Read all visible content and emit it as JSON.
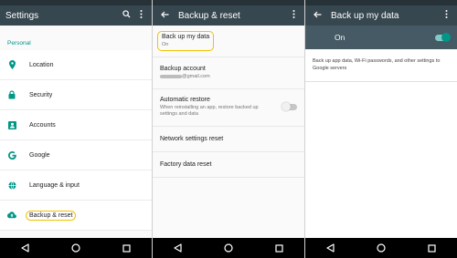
{
  "settings": {
    "title": "Settings",
    "section_label": "Personal",
    "items": [
      {
        "label": "Location",
        "icon": "location-pin-icon"
      },
      {
        "label": "Security",
        "icon": "lock-icon"
      },
      {
        "label": "Accounts",
        "icon": "account-card-icon"
      },
      {
        "label": "Google",
        "icon": "google-g-icon"
      },
      {
        "label": "Language & input",
        "icon": "globe-icon"
      },
      {
        "label": "Backup & reset",
        "icon": "cloud-upload-icon"
      }
    ]
  },
  "backup_reset": {
    "title": "Backup & reset",
    "backup_my_data": {
      "title": "Back up my data",
      "sub": "On"
    },
    "backup_account": {
      "title": "Backup account",
      "sub": "@gmail.com"
    },
    "automatic_restore": {
      "title": "Automatic restore",
      "sub": "When reinstalling an app, restore backed up settings and data",
      "enabled": false
    },
    "network_reset": {
      "title": "Network settings reset"
    },
    "factory_reset": {
      "title": "Factory data reset"
    }
  },
  "backup_data": {
    "title": "Back up my data",
    "toggle_label": "On",
    "enabled": true,
    "description": "Back up app data, Wi-Fi passwords, and other settings to Google servers"
  },
  "colors": {
    "app_bar": "#37474f",
    "status_bar": "#263238",
    "accent": "#009688",
    "highlight": "#f2c200",
    "nav_bar": "#000000"
  }
}
